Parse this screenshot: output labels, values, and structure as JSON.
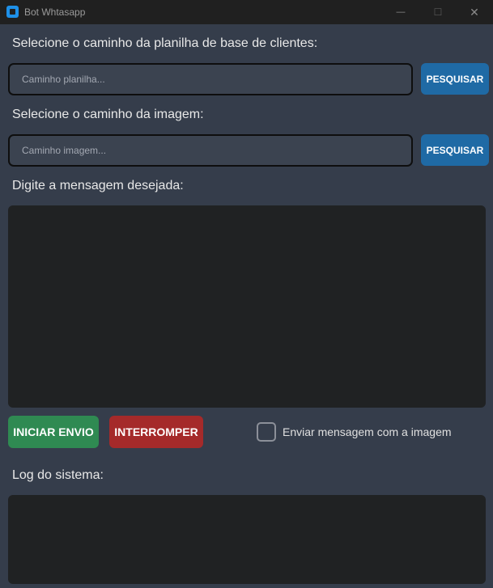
{
  "window": {
    "title": "Bot Whtasapp",
    "minimize_glyph": "—",
    "maximize_glyph": "☐",
    "close_glyph": "✕"
  },
  "spreadsheet": {
    "label": "Selecione o caminho da planilha de base de clientes:",
    "placeholder": "Caminho planilha...",
    "value": "",
    "button_label": "PESQUISAR"
  },
  "image": {
    "label": "Selecione o caminho da imagem:",
    "placeholder": "Caminho imagem...",
    "value": "",
    "button_label": "PESQUISAR"
  },
  "message": {
    "label": "Digite a mensagem desejada:",
    "value": ""
  },
  "actions": {
    "start_label": "INICIAR ENVIO",
    "stop_label": "INTERROMPER",
    "start_color": "#2f8a52",
    "stop_color": "#a52a2a"
  },
  "send_with_image": {
    "label": "Enviar mensagem com a imagem",
    "checked": false
  },
  "log": {
    "label": "Log do sistema:",
    "value": ""
  },
  "colors": {
    "background": "#353d4b",
    "accent": "#1f6aa5",
    "textarea_bg": "#202223"
  }
}
